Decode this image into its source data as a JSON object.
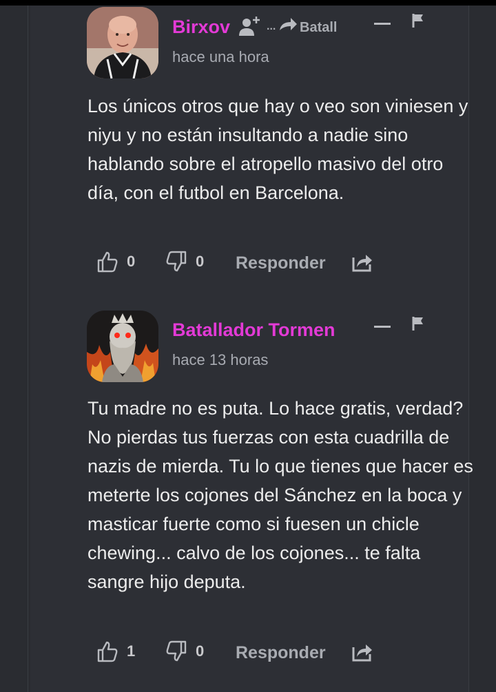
{
  "comments": [
    {
      "author": "Birxov",
      "time": "hace una hora",
      "reply_to": "...",
      "reply_to_name": "Batall",
      "text": "Los únicos otros que hay o veo son viniesen y niyu y no están insultando a nadie sino hablando sobre el atropello masivo del otro día, con el futbol en Barcelona.",
      "likes": "0",
      "dislikes": "0",
      "reply_label": "Responder"
    },
    {
      "author": "Batallador Tormen",
      "time": "hace 13 horas",
      "text": "Tu madre no es puta. Lo hace gratis, verdad? No pierdas tus fuerzas con esta cuadrilla de nazis de mierda. Tu lo que tienes que hacer es meterte los cojones del Sánchez en la boca y masticar fuerte como si fuesen un chicle chewing... calvo de los cojones... te falta sangre hijo deputa.",
      "likes": "1",
      "dislikes": "0",
      "reply_label": "Responder"
    }
  ],
  "colors": {
    "author": "#e33ad6",
    "background": "#2a2c31",
    "text": "#ececec",
    "muted": "#a8abb2"
  },
  "icons": [
    "thumbs-up-icon",
    "thumbs-down-icon",
    "share-icon",
    "flag-icon",
    "collapse-icon",
    "follow-user-icon",
    "reply-arrow-icon"
  ]
}
